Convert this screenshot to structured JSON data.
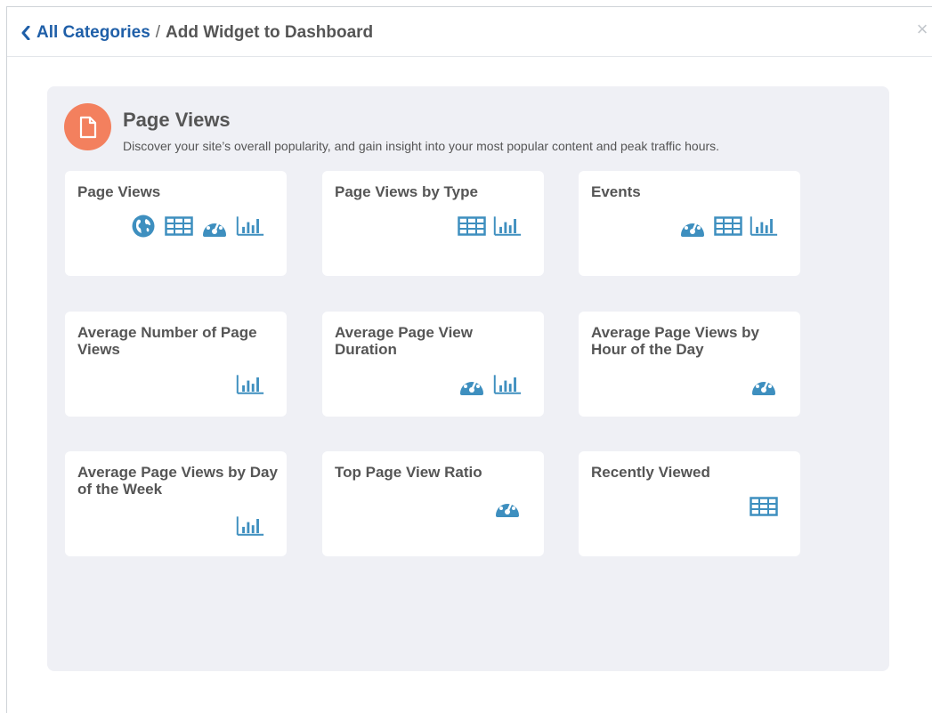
{
  "header": {
    "back_label": "All Categories",
    "separator": "/",
    "current": "Add Widget to Dashboard",
    "close_symbol": "×"
  },
  "category": {
    "icon": "document-icon",
    "title": "Page Views",
    "description": "Discover your site’s overall popularity, and gain insight into your most popular content and peak traffic hours."
  },
  "widgets": [
    {
      "title": "Page Views",
      "icons": [
        "globe-icon",
        "table-icon",
        "gauge-icon",
        "bar-chart-icon"
      ]
    },
    {
      "title": "Page Views by Type",
      "icons": [
        "table-icon",
        "bar-chart-icon"
      ]
    },
    {
      "title": "Events",
      "icons": [
        "gauge-icon",
        "table-icon",
        "bar-chart-icon"
      ]
    },
    {
      "title": "Average Number of Page Views",
      "icons": [
        "bar-chart-icon"
      ]
    },
    {
      "title": "Average Page View Duration",
      "icons": [
        "gauge-icon",
        "bar-chart-icon"
      ]
    },
    {
      "title": "Average Page Views by Hour of the Day",
      "icons": [
        "gauge-icon"
      ]
    },
    {
      "title": "Average Page Views by Day of the Week",
      "icons": [
        "bar-chart-icon"
      ]
    },
    {
      "title": "Top Page View Ratio",
      "icons": [
        "gauge-icon"
      ]
    },
    {
      "title": "Recently Viewed",
      "icons": [
        "table-icon"
      ]
    }
  ],
  "colors": {
    "accent": "#1f5fa8",
    "icon": "#3e8fbf",
    "category_icon_bg": "#f3805e",
    "panel_bg": "#eff0f5"
  }
}
